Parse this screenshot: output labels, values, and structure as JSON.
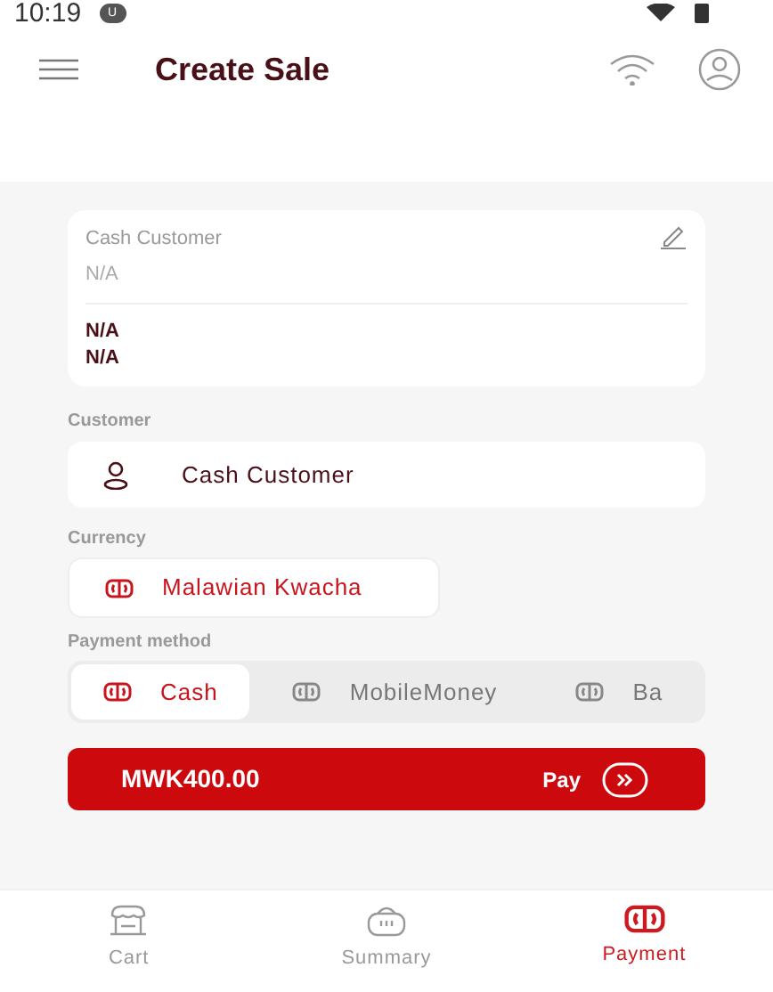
{
  "status_bar": {
    "time": "10:19",
    "badge": "U"
  },
  "header": {
    "title": "Create Sale"
  },
  "customer_card": {
    "name": "Cash Customer",
    "subtitle": "N/A",
    "lines": [
      "N/A",
      "N/A"
    ]
  },
  "customer": {
    "label": "Customer",
    "value": "Cash Customer"
  },
  "currency": {
    "label": "Currency",
    "value": "Malawian Kwacha"
  },
  "payment_method": {
    "label": "Payment method",
    "options": [
      {
        "label": "Cash",
        "selected": true
      },
      {
        "label": "MobileMoney",
        "selected": false
      },
      {
        "label": "Ba",
        "selected": false
      }
    ]
  },
  "pay_button": {
    "amount": "MWK400.00",
    "label": "Pay"
  },
  "bottom_nav": [
    {
      "label": "Cart",
      "kind": "cart",
      "selected": false
    },
    {
      "label": "Summary",
      "kind": "basket",
      "selected": false
    },
    {
      "label": "Payment",
      "kind": "money",
      "selected": true
    }
  ]
}
